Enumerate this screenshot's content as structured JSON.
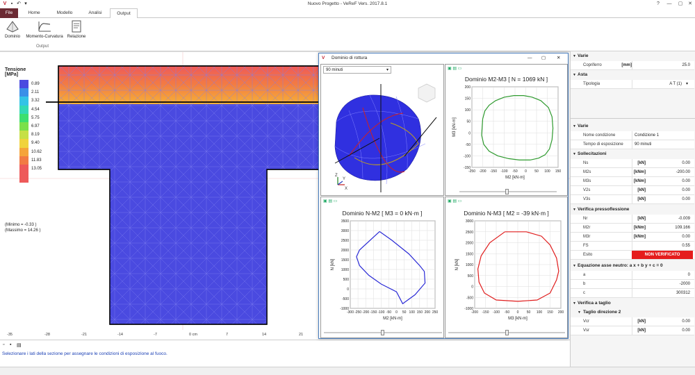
{
  "window": {
    "title": "Nuovo Progetto - VeReF Vers. 2017.8.1",
    "controls": [
      "?",
      "—",
      "▢",
      "✕"
    ]
  },
  "menu": {
    "file": "File",
    "tabs": [
      "Home",
      "Modello",
      "Analisi",
      "Output"
    ]
  },
  "ribbon": {
    "buttons": [
      "Dominio",
      "Momento-Curvatura",
      "Relazione"
    ],
    "group": "Output"
  },
  "legend": {
    "title": "Tensione [MPa]",
    "values": [
      "0.89",
      "2.11",
      "3.32",
      "4.54",
      "5.75",
      "6.97",
      "8.19",
      "9.40",
      "10.62",
      "11.83",
      "13.05"
    ],
    "colors": [
      "#4a4ae0",
      "#3a8fe8",
      "#33c3e6",
      "#32d9b4",
      "#3cdf6e",
      "#7be04a",
      "#c6e046",
      "#f0d33c",
      "#f5a43a",
      "#f27b44",
      "#ee5a5a"
    ],
    "min_label": "(Minimo  = -0.33 )",
    "max_label": "(Massimo = 14.26 )"
  },
  "ruler": {
    "ticks": [
      "-35",
      "-28",
      "-21",
      "-14",
      "-7",
      "0 cm",
      "7",
      "14",
      "21"
    ]
  },
  "status": {
    "message": "Selezionare i lati della sezione per assegnare le condizioni di esposizione al fuoco."
  },
  "dialog": {
    "title": "Dominio di rottura",
    "controls": [
      "—",
      "▢",
      "✕"
    ],
    "dropdown": "90 minuti",
    "pane3d_axes": [
      "Z",
      "Y",
      "X"
    ],
    "m2m3": {
      "title": "Dominio M2-M3 [ N = 1069 kN ]",
      "xlabel": "M2 [kN·m]",
      "ylabel": "M3 [kN·m]"
    },
    "nm2": {
      "title": "Dominio N-M2 [ M3 = 0 kN·m ]",
      "xlabel": "M2 [kN·m]",
      "ylabel": "N [kN]"
    },
    "nm3": {
      "title": "Dominio N-M3 [ M2 = -39 kN·m ]",
      "xlabel": "M3 [kN·m]",
      "ylabel": "N [kN]"
    }
  },
  "chart_data": [
    {
      "type": "line",
      "title": "Dominio M2-M3 [ N = 1069 kN ]",
      "xlabel": "M2 [kN·m]",
      "ylabel": "M3 [kN·m]",
      "xlim": [
        -250,
        150
      ],
      "ylim": [
        -150,
        200
      ],
      "xticks": [
        -250,
        -200,
        -150,
        -100,
        -50,
        0,
        50,
        100,
        150
      ],
      "yticks": [
        -150,
        -100,
        -50,
        0,
        50,
        100,
        150,
        200
      ],
      "color": "#2e9a2e",
      "x": [
        -200,
        -190,
        -170,
        -140,
        -100,
        -55,
        -10,
        30,
        70,
        105,
        122,
        126,
        122,
        110,
        90,
        60,
        20,
        -30,
        -80,
        -130,
        -170,
        -195,
        -205,
        -200
      ],
      "y": [
        60,
        95,
        120,
        140,
        155,
        162,
        162,
        155,
        140,
        110,
        70,
        20,
        -30,
        -70,
        -95,
        -110,
        -118,
        -118,
        -112,
        -100,
        -80,
        -50,
        -10,
        60
      ]
    },
    {
      "type": "line",
      "title": "Dominio N-M2 [ M3 = 0 kN·m ]",
      "xlabel": "M2 [kN·m]",
      "ylabel": "N [kN]",
      "xlim": [
        -300,
        250
      ],
      "ylim": [
        -1000,
        3500
      ],
      "xticks": [
        -300,
        -250,
        -200,
        -150,
        -100,
        -50,
        0,
        50,
        100,
        150,
        200,
        250
      ],
      "yticks": [
        -1000,
        -500,
        0,
        500,
        1000,
        1500,
        2000,
        2500,
        3000,
        3500
      ],
      "color": "#2a2ad6",
      "x": [
        -110,
        -240,
        -260,
        -240,
        -180,
        -100,
        0,
        40,
        120,
        185,
        180,
        150,
        80,
        -30,
        -110
      ],
      "y": [
        2950,
        2000,
        1650,
        1200,
        700,
        250,
        -150,
        -760,
        -300,
        300,
        900,
        1200,
        1800,
        2500,
        2950
      ]
    },
    {
      "type": "line",
      "title": "Dominio N-M3 [ M2 = -39 kN·m ]",
      "xlabel": "M3 [kN·m]",
      "ylabel": "N [kN]",
      "xlim": [
        -200,
        200
      ],
      "ylim": [
        -1000,
        3000
      ],
      "xticks": [
        -200,
        -150,
        -100,
        -50,
        0,
        50,
        100,
        150,
        200
      ],
      "yticks": [
        -1000,
        -500,
        0,
        500,
        1000,
        1500,
        2000,
        2500,
        3000
      ],
      "color": "#e01c1c",
      "x": [
        -60,
        40,
        110,
        150,
        180,
        190,
        180,
        150,
        90,
        0,
        -100,
        -155,
        -180,
        -185,
        -170,
        -130,
        -60
      ],
      "y": [
        2500,
        2500,
        2300,
        1900,
        1300,
        700,
        300,
        -300,
        -620,
        -680,
        -620,
        -300,
        200,
        800,
        1400,
        2000,
        2500
      ]
    }
  ],
  "properties": {
    "varie1": {
      "header": "Varie",
      "rows": [
        {
          "k": "Copriferro",
          "u": "[mm]",
          "v": "25.0"
        }
      ]
    },
    "asta": {
      "header": "Asta",
      "rows": [
        {
          "k": "Tipologia",
          "v": "A T (1)"
        }
      ]
    },
    "varie2": {
      "header": "Varie",
      "rows": [
        {
          "k": "Nome condizione",
          "v": "Condizione 1"
        },
        {
          "k": "Tempo di esposizione",
          "v": "90 minuti"
        }
      ]
    },
    "sollecitazioni": {
      "header": "Sollecitazioni",
      "rows": [
        {
          "k": "Ns",
          "u": "[kN]",
          "v": "0.00"
        },
        {
          "k": "M2s",
          "u": "[kNm]",
          "v": "-200.00"
        },
        {
          "k": "M3s",
          "u": "[kNm]",
          "v": "0.00"
        },
        {
          "k": "V2s",
          "u": "[kN]",
          "v": "0.00"
        },
        {
          "k": "V3s",
          "u": "[kN]",
          "v": "0.00"
        }
      ]
    },
    "verifica": {
      "header": "Verifica pressoflessione",
      "rows": [
        {
          "k": "Nr",
          "u": "[kN]",
          "v": "-0.009"
        },
        {
          "k": "M2r",
          "u": "[kNm]",
          "v": "109.166"
        },
        {
          "k": "M3r",
          "u": "[kNm]",
          "v": "0.00"
        },
        {
          "k": "FS",
          "v": "0.55"
        },
        {
          "k": "Esito",
          "v": "NON VERIFICATO"
        }
      ]
    },
    "asse": {
      "header": "Equazione asse neutro: a x + b y + c = 0",
      "rows": [
        {
          "k": "a",
          "v": "0"
        },
        {
          "k": "b",
          "v": "-2000"
        },
        {
          "k": "c",
          "v": "300312"
        }
      ]
    },
    "taglio": {
      "header": "Verifica a taglio",
      "sub": "Taglio direzione 2",
      "rows": [
        {
          "k": "Vcr",
          "u": "[kN]",
          "v": "0.00"
        },
        {
          "k": "Vsr",
          "u": "[kN]",
          "v": "0.00"
        }
      ]
    }
  }
}
